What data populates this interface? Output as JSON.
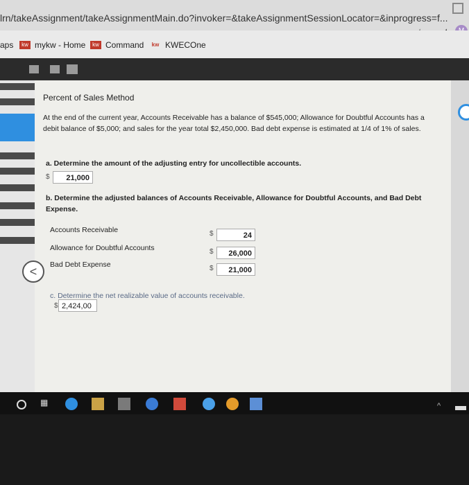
{
  "browser": {
    "url": "lrn/takeAssignment/takeAssignmentMain.do?invoker=&takeAssignmentSessionLocator=&inprogress=f...",
    "profile_initial": "M"
  },
  "bookmarks": {
    "apps_label": "aps",
    "items": [
      {
        "icon": "kw",
        "label": "mykw - Home"
      },
      {
        "icon": "kw",
        "label": "Command"
      },
      {
        "icon": "kw",
        "label": "KWECOne"
      }
    ]
  },
  "problem": {
    "title": "Percent of Sales Method",
    "description": "At the end of the current year, Accounts Receivable has a balance of $545,000; Allowance for Doubtful Accounts has a debit balance of $5,000; and sales for the year total $2,450,000. Bad debt expense is estimated at 1/4 of 1% of sales.",
    "part_a": {
      "question": "a. Determine the amount of the adjusting entry for uncollectible accounts.",
      "currency": "$",
      "answer": "21,000"
    },
    "part_b": {
      "question": "b. Determine the adjusted balances of Accounts Receivable, Allowance for Doubtful Accounts, and Bad Debt Expense.",
      "rows": [
        {
          "label": "Accounts Receivable",
          "currency": "$",
          "value": "24"
        },
        {
          "label": "Allowance for Doubtful Accounts",
          "currency": "$",
          "value": "26,000"
        },
        {
          "label": "Bad Debt Expense",
          "currency": "$",
          "value": "21,000"
        }
      ]
    },
    "part_c": {
      "question": "c. Determine the net realizable value of accounts receivable.",
      "currency": "$",
      "answer": "2,424,00"
    }
  },
  "colors": {
    "accent": "#2f8fe0",
    "content_bg": "#efefeb",
    "appbar": "#2b2b2b"
  }
}
